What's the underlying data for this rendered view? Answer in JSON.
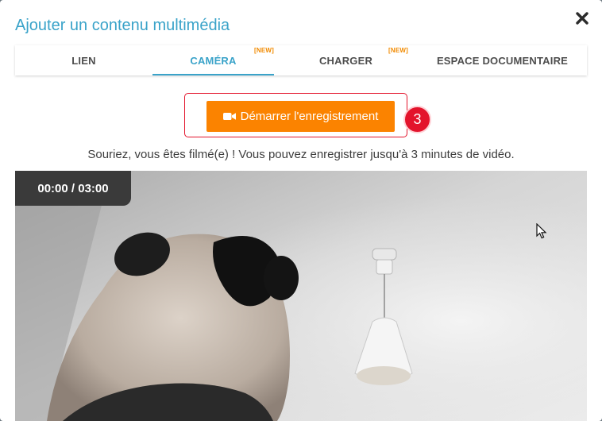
{
  "modal": {
    "title": "Ajouter un contenu multimédia",
    "close_icon": "close-icon"
  },
  "tabs": [
    {
      "label": "LIEN",
      "active": false,
      "badge": ""
    },
    {
      "label": "CAMÉRA",
      "active": true,
      "badge": "[NEW]"
    },
    {
      "label": "CHARGER",
      "active": false,
      "badge": "[NEW]"
    },
    {
      "label": "ESPACE DOCUMENTAIRE",
      "active": false,
      "badge": ""
    }
  ],
  "recorder": {
    "start_label": "Démarrer l'enregistrement",
    "start_icon": "video-camera-icon",
    "step_number": "3",
    "hint": "Souriez, vous êtes filmé(e) ! Vous pouvez enregistrer jusqu'à 3 minutes de vidéo.",
    "timer": "00:00 / 03:00"
  },
  "colors": {
    "accent": "#3aa3c9",
    "record_button": "#fb8300",
    "highlight": "#e3142c",
    "new_badge": "#f18a00"
  }
}
